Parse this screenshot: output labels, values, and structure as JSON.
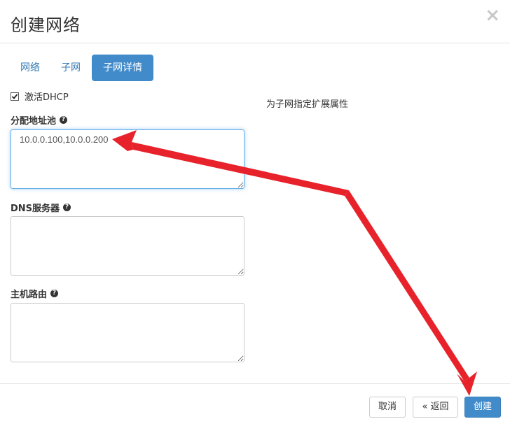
{
  "modal": {
    "title": "创建网络",
    "close_glyph": "×"
  },
  "tabs": [
    {
      "label": "网络",
      "active": false
    },
    {
      "label": "子网",
      "active": false
    },
    {
      "label": "子网详情",
      "active": true
    }
  ],
  "dhcp": {
    "label": "激活DHCP",
    "checked": true
  },
  "side_help": "为子网指定扩展属性",
  "fields": {
    "allocation_pools": {
      "label": "分配地址池",
      "value": "10.0.0.100,10.0.0.200"
    },
    "dns_servers": {
      "label": "DNS服务器",
      "value": ""
    },
    "host_routes": {
      "label": "主机路由",
      "value": ""
    }
  },
  "footer": {
    "cancel_label": "取消",
    "back_label": "« 返回",
    "create_label": "创建"
  },
  "annotation_color": "#e8222b",
  "icons": [
    "close-icon",
    "check-icon",
    "question-circle-icon"
  ]
}
